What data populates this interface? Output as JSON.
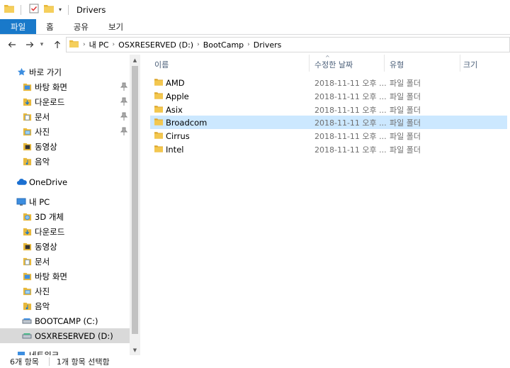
{
  "window": {
    "title": "Drivers"
  },
  "ribbon": {
    "tabs": [
      "파일",
      "홈",
      "공유",
      "보기"
    ]
  },
  "address": {
    "crumbs": [
      "내 PC",
      "OSXRESERVED (D:)",
      "BootCamp",
      "Drivers"
    ]
  },
  "nav": {
    "quick_access": "바로 가기",
    "quick_items": [
      "바탕 화면",
      "다운로드",
      "문서",
      "사진",
      "동영상",
      "음악"
    ],
    "onedrive": "OneDrive",
    "this_pc": "내 PC",
    "pc_items": [
      "3D 개체",
      "다운로드",
      "동영상",
      "문서",
      "바탕 화면",
      "사진",
      "음악"
    ],
    "drives": [
      "BOOTCAMP (C:)",
      "OSXRESERVED (D:)"
    ],
    "network": "네트워크",
    "selected": "OSXRESERVED (D:)"
  },
  "columns": {
    "name": "이름",
    "date": "수정한 날짜",
    "type": "유형",
    "size": "크기"
  },
  "files": [
    {
      "name": "AMD",
      "date": "2018-11-11 오후 ...",
      "type": "파일 폴더"
    },
    {
      "name": "Apple",
      "date": "2018-11-11 오후 ...",
      "type": "파일 폴더"
    },
    {
      "name": "Asix",
      "date": "2018-11-11 오후 ...",
      "type": "파일 폴더"
    },
    {
      "name": "Broadcom",
      "date": "2018-11-11 오후 ...",
      "type": "파일 폴더"
    },
    {
      "name": "Cirrus",
      "date": "2018-11-11 오후 ...",
      "type": "파일 폴더"
    },
    {
      "name": "Intel",
      "date": "2018-11-11 오후 ...",
      "type": "파일 폴더"
    }
  ],
  "selected_file": "Broadcom",
  "status": {
    "count": "6개 항목",
    "selection": "1개 항목 선택함"
  },
  "colors": {
    "accent": "#1979ca",
    "selection": "#cce8ff",
    "folder": "#e8b83a",
    "nav_selected": "#d9d9d9"
  },
  "icons": {
    "folder": "folder-icon",
    "star": "star-icon",
    "cloud": "onedrive-icon",
    "pc": "computer-icon",
    "drive": "drive-icon",
    "pin": "pin-icon"
  }
}
